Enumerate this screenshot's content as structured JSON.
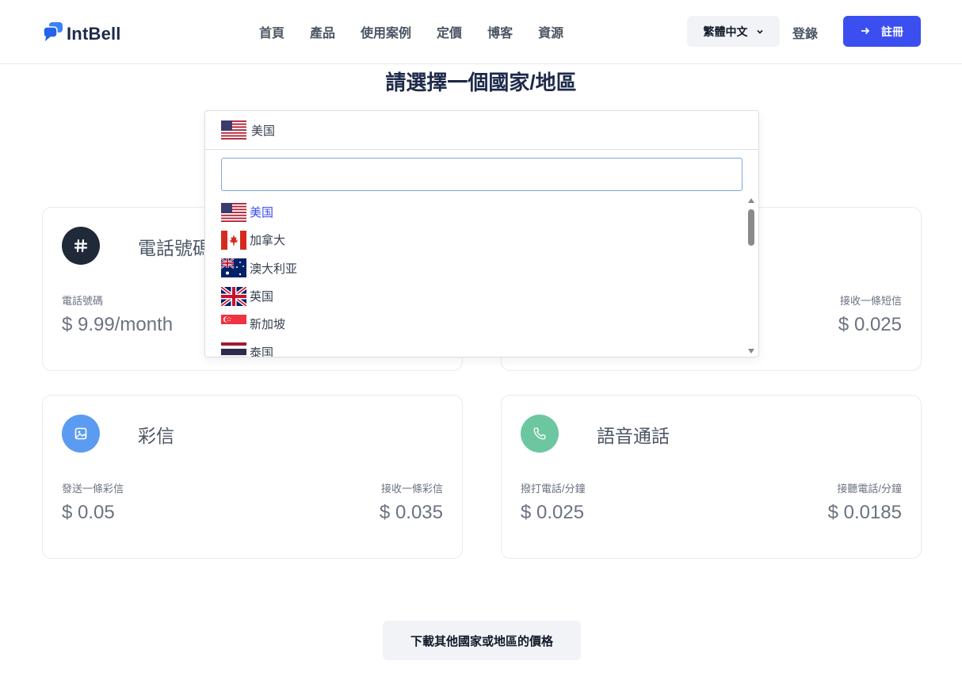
{
  "header": {
    "logo_text": "IntBell",
    "nav": [
      "首頁",
      "產品",
      "使用案例",
      "定價",
      "博客",
      "資源"
    ],
    "language": "繁體中文",
    "login": "登錄",
    "register": "註冊"
  },
  "page_title": "請選擇一個國家/地區",
  "dropdown": {
    "selected": "美国",
    "search_value": "",
    "options": [
      {
        "label": "美国",
        "flag": "us-flag",
        "active": true
      },
      {
        "label": "加拿大",
        "flag": "ca-flag",
        "active": false
      },
      {
        "label": "澳大利亚",
        "flag": "au-flag",
        "active": false
      },
      {
        "label": "英国",
        "flag": "gb-flag",
        "active": false
      },
      {
        "label": "新加坡",
        "flag": "sg-flag",
        "active": false
      },
      {
        "label": "泰国",
        "flag": "th-flag",
        "active": false
      }
    ]
  },
  "cards": {
    "phone": {
      "title": "電話號碼",
      "left_label": "電話號碼",
      "left_value": "$ 9.99/month",
      "icon": "hash-icon",
      "icon_color": "#1f2937"
    },
    "sms": {
      "right_label": "接收一條短信",
      "right_value": "$ 0.025"
    },
    "mms": {
      "title": "彩信",
      "left_label": "發送一條彩信",
      "left_value": "$ 0.05",
      "right_label": "接收一條彩信",
      "right_value": "$ 0.035",
      "icon": "image-icon",
      "icon_color": "#5b9cf2"
    },
    "voice": {
      "title": "語音通話",
      "left_label": "撥打電話/分鐘",
      "left_value": "$ 0.025",
      "right_label": "接聽電話/分鐘",
      "right_value": "$ 0.0185",
      "icon": "phone-icon",
      "icon_color": "#6cc7a0"
    }
  },
  "download_button": "下載其他國家或地區的價格",
  "colors": {
    "primary": "#3b4ff0",
    "heading": "#1e2a4a",
    "muted_text": "#6b7280"
  }
}
